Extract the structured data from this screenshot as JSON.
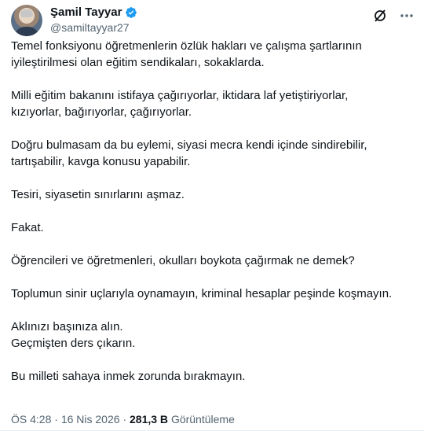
{
  "author": {
    "display_name": "Şamil Tayyar",
    "handle": "@samiltayyar27",
    "verified_color": "#1d9bf0"
  },
  "icons": [
    "grok-icon",
    "more-icon"
  ],
  "tweet": {
    "paragraphs": [
      [
        "Temel fonksiyonu öğretmenlerin özlük hakları ve çalışma şartlarının",
        "iyileştirilmesi olan eğitim sendikaları, sokaklarda."
      ],
      [
        "Milli eğitim bakanını istifaya çağırıyorlar, iktidara laf yetiştiriyorlar,",
        "kızıyorlar, bağırıyorlar, çağırıyorlar."
      ],
      [
        "Doğru bulmasam da bu eylemi, siyasi mecra kendi içinde sindirebilir,",
        "tartışabilir, kavga konusu yapabilir."
      ],
      [
        "Tesiri, siyasetin sınırlarını aşmaz."
      ],
      [
        "Fakat."
      ],
      [
        "Öğrencileri ve öğretmenleri, okulları boykota çağırmak ne demek?"
      ],
      [
        "Toplumun sinir uçlarıyla oynamayın, kriminal hesaplar peşinde koşmayın."
      ],
      [
        "Aklınızı başınıza alın.",
        "Geçmişten ders çıkarın."
      ],
      [
        "Bu milleti sahaya inmek zorunda bırakmayın."
      ]
    ]
  },
  "meta": {
    "time": "ÖS 4:28",
    "separator": "·",
    "date": "16 Nis 2026",
    "views_count": "281,3 B",
    "views_label": "Görüntüleme"
  }
}
